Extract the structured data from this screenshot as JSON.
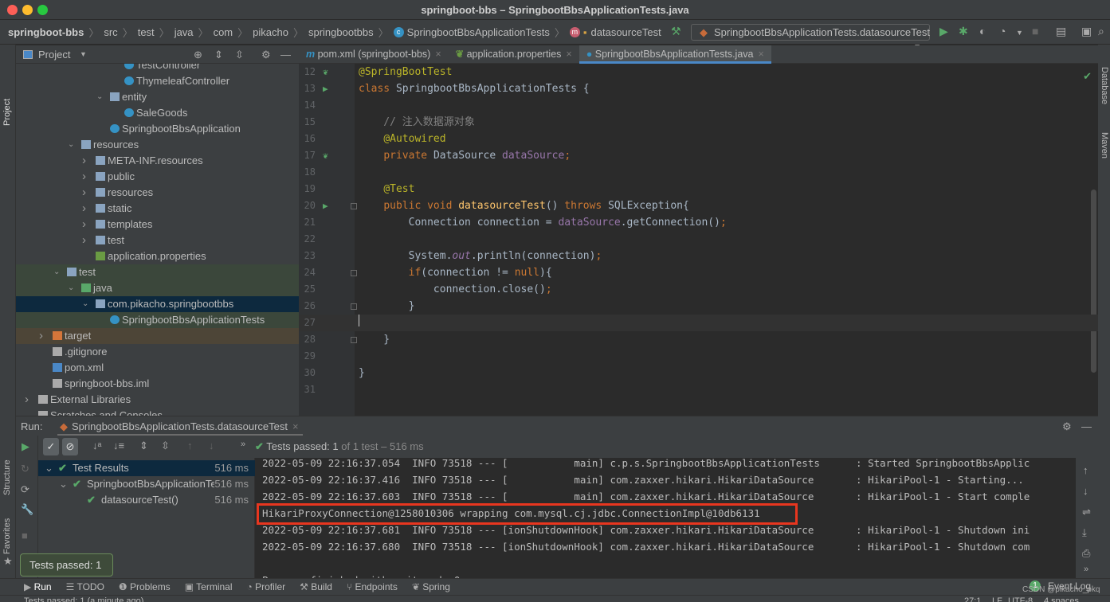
{
  "window": {
    "title": "springboot-bbs – SpringbootBbsApplicationTests.java"
  },
  "breadcrumb": [
    "springboot-bbs",
    "src",
    "test",
    "java",
    "com",
    "pikacho",
    "springbootbbs",
    "SpringbootBbsApplicationTests",
    "datasourceTest"
  ],
  "toolbar": {
    "run_config": "SpringbootBbsApplicationTests.datasourceTest"
  },
  "left_strip": {
    "project": "Project",
    "structure": "Structure",
    "favorites": "Favorites"
  },
  "right_strip": {
    "database": "Database",
    "maven": "Maven"
  },
  "project_panel": {
    "title": "Project",
    "items": [
      {
        "label": "TestController",
        "depth": 6,
        "kind": "class"
      },
      {
        "label": "ThymeleafController",
        "depth": 6,
        "kind": "class"
      },
      {
        "label": "entity",
        "depth": 5,
        "kind": "package",
        "expanded": true
      },
      {
        "label": "SaleGoods",
        "depth": 6,
        "kind": "class"
      },
      {
        "label": "SpringbootBbsApplication",
        "depth": 5,
        "kind": "spring-class"
      },
      {
        "label": "resources",
        "depth": 3,
        "kind": "resources",
        "expanded": true
      },
      {
        "label": "META-INF.resources",
        "depth": 4,
        "kind": "folder",
        "expanded": false
      },
      {
        "label": "public",
        "depth": 4,
        "kind": "folder",
        "expanded": false
      },
      {
        "label": "resources",
        "depth": 4,
        "kind": "folder",
        "expanded": false
      },
      {
        "label": "static",
        "depth": 4,
        "kind": "folder",
        "expanded": false
      },
      {
        "label": "templates",
        "depth": 4,
        "kind": "folder",
        "expanded": false
      },
      {
        "label": "test",
        "depth": 4,
        "kind": "folder",
        "expanded": false
      },
      {
        "label": "application.properties",
        "depth": 4,
        "kind": "properties"
      },
      {
        "label": "test",
        "depth": 2,
        "kind": "folder",
        "expanded": true,
        "highlight": "test"
      },
      {
        "label": "java",
        "depth": 3,
        "kind": "test-folder",
        "expanded": true,
        "highlight": "test"
      },
      {
        "label": "com.pikacho.springbootbbs",
        "depth": 4,
        "kind": "package",
        "expanded": true,
        "highlight": "selected"
      },
      {
        "label": "SpringbootBbsApplicationTests",
        "depth": 5,
        "kind": "class",
        "highlight": "test"
      },
      {
        "label": "target",
        "depth": 1,
        "kind": "excluded-folder",
        "expanded": false,
        "highlight": "excluded"
      },
      {
        "label": ".gitignore",
        "depth": 1,
        "kind": "file"
      },
      {
        "label": "pom.xml",
        "depth": 1,
        "kind": "maven"
      },
      {
        "label": "springboot-bbs.iml",
        "depth": 1,
        "kind": "file"
      },
      {
        "label": "External Libraries",
        "depth": 0,
        "kind": "library",
        "expanded": false
      },
      {
        "label": "Scratches and Consoles",
        "depth": 0,
        "kind": "scratch"
      }
    ]
  },
  "editor_tabs": [
    {
      "label": "pom.xml (springboot-bbs)",
      "icon": "maven-icon",
      "active": false
    },
    {
      "label": "application.properties",
      "icon": "spring-icon",
      "active": false
    },
    {
      "label": "SpringbootBbsApplicationTests.java",
      "icon": "class-icon",
      "active": true
    }
  ],
  "code_lines": [
    {
      "n": "12",
      "gutter": "spring",
      "tokens": [
        [
          "@SpringBootTest",
          "an"
        ]
      ]
    },
    {
      "n": "13",
      "gutter": "run",
      "tokens": [
        [
          "class ",
          "k"
        ],
        [
          "SpringbootBbsApplicationTests {",
          ""
        ]
      ]
    },
    {
      "n": "14",
      "tokens": []
    },
    {
      "n": "15",
      "tokens": [
        [
          "    // 注入数据源对象",
          "cm"
        ]
      ]
    },
    {
      "n": "16",
      "tokens": [
        [
          "    ",
          ""
        ],
        [
          "@Autowired",
          "an"
        ]
      ]
    },
    {
      "n": "17",
      "gutter": "bean",
      "tokens": [
        [
          "    ",
          ""
        ],
        [
          "private ",
          "k"
        ],
        [
          "DataSource ",
          ""
        ],
        [
          "dataSource",
          "f"
        ],
        [
          ";",
          "k"
        ]
      ]
    },
    {
      "n": "18",
      "tokens": []
    },
    {
      "n": "19",
      "tokens": [
        [
          "    ",
          ""
        ],
        [
          "@Test",
          "an"
        ]
      ]
    },
    {
      "n": "20",
      "gutter": "run",
      "fold": true,
      "tokens": [
        [
          "    ",
          ""
        ],
        [
          "public void ",
          "k"
        ],
        [
          "datasourceTest",
          "md"
        ],
        [
          "() ",
          ""
        ],
        [
          "throws ",
          "k"
        ],
        [
          "SQLException{",
          ""
        ]
      ]
    },
    {
      "n": "21",
      "tokens": [
        [
          "        Connection connection = ",
          ""
        ],
        [
          "dataSource",
          "f"
        ],
        [
          ".getConnection()",
          ""
        ],
        [
          ";",
          "k"
        ]
      ]
    },
    {
      "n": "22",
      "tokens": []
    },
    {
      "n": "23",
      "tokens": [
        [
          "        System.",
          ""
        ],
        [
          "out",
          "it"
        ],
        [
          ".println(connection)",
          ""
        ],
        [
          ";",
          "k"
        ]
      ]
    },
    {
      "n": "24",
      "fold": true,
      "tokens": [
        [
          "        ",
          ""
        ],
        [
          "if",
          "k"
        ],
        [
          "(connection != ",
          ""
        ],
        [
          "null",
          "k"
        ],
        [
          "){",
          ""
        ]
      ]
    },
    {
      "n": "25",
      "tokens": [
        [
          "            connection.close()",
          ""
        ],
        [
          ";",
          "k"
        ]
      ]
    },
    {
      "n": "26",
      "fold": true,
      "tokens": [
        [
          "        }",
          ""
        ]
      ]
    },
    {
      "n": "27",
      "current": true,
      "tokens": []
    },
    {
      "n": "28",
      "fold": true,
      "tokens": [
        [
          "    }",
          ""
        ]
      ]
    },
    {
      "n": "29",
      "tokens": []
    },
    {
      "n": "30",
      "tokens": [
        [
          "}",
          ""
        ]
      ]
    },
    {
      "n": "31",
      "tokens": []
    }
  ],
  "run_panel": {
    "label": "Run:",
    "tab": "SpringbootBbsApplicationTests.datasourceTest",
    "status_prefix": "Tests passed:",
    "status_count": "1",
    "status_suffix": "of 1 test – 516 ms",
    "results": [
      {
        "label": "Test Results",
        "time": "516 ms",
        "depth": 0
      },
      {
        "label": "SpringbootBbsApplicationTests",
        "time": "516 ms",
        "depth": 1
      },
      {
        "label": "datasourceTest()",
        "time": "516 ms",
        "depth": 2
      }
    ],
    "console": [
      "2022-05-09 22:16:37.054  INFO 73518 --- [           main] c.p.s.SpringbootBbsApplicationTests      : Started SpringbootBbsApplic",
      "2022-05-09 22:16:37.416  INFO 73518 --- [           main] com.zaxxer.hikari.HikariDataSource       : HikariPool-1 - Starting...",
      "2022-05-09 22:16:37.603  INFO 73518 --- [           main] com.zaxxer.hikari.HikariDataSource       : HikariPool-1 - Start comple",
      "HikariProxyConnection@1258010306 wrapping com.mysql.cj.jdbc.ConnectionImpl@10db6131",
      "2022-05-09 22:16:37.681  INFO 73518 --- [ionShutdownHook] com.zaxxer.hikari.HikariDataSource       : HikariPool-1 - Shutdown ini",
      "2022-05-09 22:16:37.680  INFO 73518 --- [ionShutdownHook] com.zaxxer.hikari.HikariDataSource       : HikariPool-1 - Shutdown com",
      "",
      "Process finished with exit code 0"
    ],
    "tooltip": "Tests passed: 1"
  },
  "bottom_tools": [
    "Run",
    "TODO",
    "Problems",
    "Terminal",
    "Profiler",
    "Build",
    "Endpoints",
    "Spring"
  ],
  "event_log": {
    "label": "Event Log",
    "count": "1"
  },
  "watermark": "CSDN @pikacho_pkq",
  "status_bar": {
    "message": "Tests passed: 1 (a minute ago)",
    "position": "27:1",
    "line_sep": "LF",
    "encoding": "UTF-8",
    "indent": "4 spaces"
  },
  "colors": {
    "accent": "#4a88c7",
    "success": "#59a869",
    "highlight_box": "#e8361f"
  }
}
